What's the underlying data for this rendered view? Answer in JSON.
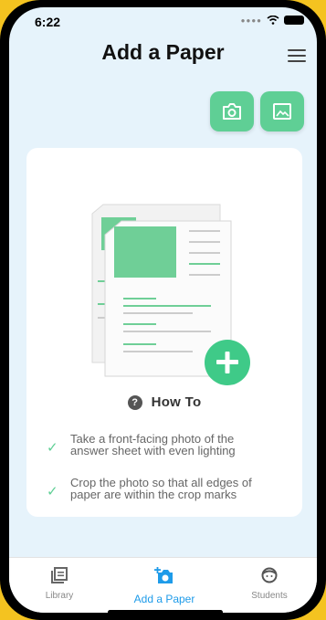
{
  "status": {
    "time": "6:22"
  },
  "header": {
    "title": "Add a Paper"
  },
  "howto": {
    "label": "How To",
    "tips": [
      {
        "line1": "Take a front-facing photo of the",
        "line2": "answer sheet with even lighting"
      },
      {
        "line1": "Crop the photo so that all edges of",
        "line2": "paper are within the crop marks"
      }
    ]
  },
  "tabbar": {
    "items": [
      {
        "label": "Library"
      },
      {
        "label": "Add a Paper"
      },
      {
        "label": "Students"
      }
    ]
  },
  "colors": {
    "accent": "#5fcf95",
    "active_tab": "#1e9be9",
    "background": "#e6f3fb",
    "frame": "#f4c320"
  },
  "icons": [
    "camera-icon",
    "image-icon",
    "menu-icon",
    "add-icon",
    "question-icon",
    "check-icon",
    "library-icon",
    "add-photo-icon",
    "student-face-icon"
  ]
}
